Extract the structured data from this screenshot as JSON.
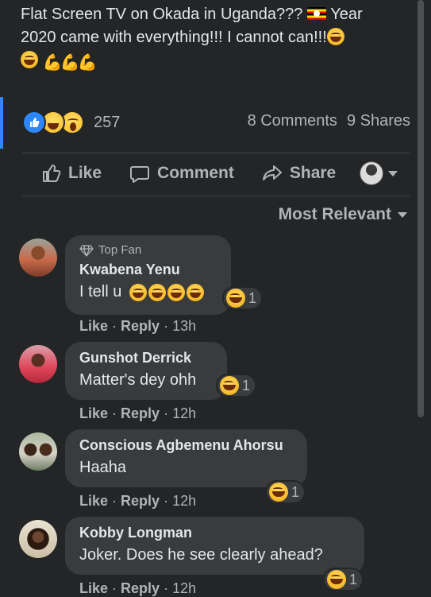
{
  "post": {
    "text_line1": "Flat Screen TV on Okada in Uganda???",
    "text_line1_end": "Year",
    "text_line2": "2020 came with everything!!! I cannot can!!!",
    "flag_icon": "uganda-flag-icon",
    "muscle_icon": "flexed-biceps-icon"
  },
  "stats": {
    "reaction_count": "257",
    "comments": "8 Comments",
    "shares": "9 Shares"
  },
  "actions": {
    "like": "Like",
    "comment": "Comment",
    "share": "Share"
  },
  "sort": {
    "label": "Most Relevant"
  },
  "comments": [
    {
      "badge": "Top Fan",
      "name": "Kwabena Yenu",
      "text": "I tell u",
      "reactions": "1",
      "like": "Like",
      "reply": "Reply",
      "time": "13h"
    },
    {
      "name": "Gunshot Derrick",
      "text": "Matter's dey ohh",
      "reactions": "1",
      "like": "Like",
      "reply": "Reply",
      "time": "12h"
    },
    {
      "name": "Conscious Agbemenu Ahorsu",
      "text": "Haaha",
      "reactions": "1",
      "like": "Like",
      "reply": "Reply",
      "time": "12h"
    },
    {
      "name": "Kobby Longman",
      "text": "Joker. Does he see clearly ahead?",
      "reactions": "1",
      "like": "Like",
      "reply": "Reply",
      "time": "12h"
    }
  ],
  "colors": {
    "background": "#242526",
    "bubble": "#3a3b3c",
    "text": "#e4e6eb",
    "muted": "#b0b3b8",
    "accent": "#2d88ff"
  }
}
